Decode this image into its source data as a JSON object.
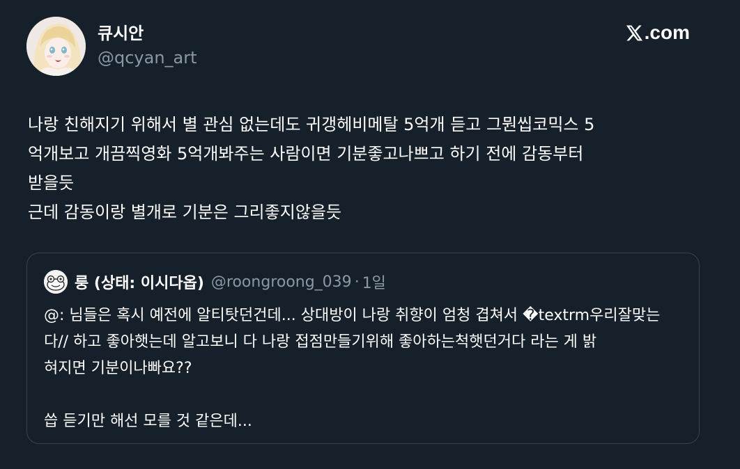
{
  "author": {
    "display_name": "큐시안",
    "handle": "@qcyan_art",
    "avatar_icon": "anime-girl-avatar-icon"
  },
  "brand": {
    "logo_icon": "x-logo-icon",
    "label": ".com"
  },
  "tweet": {
    "lines": [
      "나랑 친해지기 위해서 별 관심 없는데도 귀갱헤비메탈 5억개 듣고 그뭔씹코믹스 5",
      "억개보고 개끔찍영화 5억개봐주는 사람이면 기분좋고나쁘고 하기 전에 감동부터",
      "받을듯",
      "근데 감동이랑 별개로 기분은 그리좋지않을듯"
    ]
  },
  "quoted_tweet": {
    "display_name": "룽 (상태: 이시다옵)",
    "handle": "@roongroong_039",
    "separator": "·",
    "time": "1일",
    "avatar_icon": "frog-avatar-icon",
    "lines": [
      "@: 님들은 혹시 예전에 알티탓던건데... 상대방이 나랑  취향이 엄청 겹쳐서 �textrm우리잘맞는",
      "다// 하고 좋아햇는데 알고보니 다 나랑 접점만들기위해 좋아하는척햇던거다 라는 게 밝",
      "혀지면 기분이나빠요??",
      "",
      "씁 듣기만 해선 모를 것 같은데..."
    ]
  },
  "colors": {
    "background": "#15202b",
    "text_primary": "#ffffff",
    "text_secondary": "#8b98a5",
    "border": "#38444d"
  }
}
